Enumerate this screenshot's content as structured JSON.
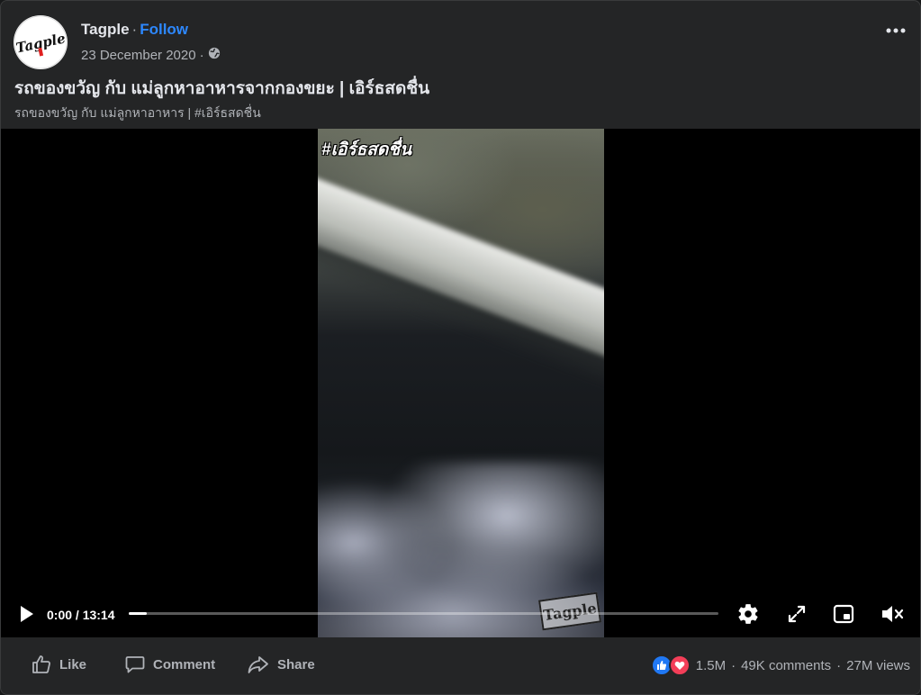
{
  "post": {
    "page_name": "Tagple",
    "follow_label": "Follow",
    "separator": "·",
    "date": "23 December 2020",
    "date_separator": "·",
    "audience_icon": "globe-icon",
    "more_icon": "more-horizontal-icon",
    "avatar_text": "Tagple",
    "title": "รถของขวัญ กับ แม่ลูกหาอาหารจากกองขยะ | เอิร์ธสดชื่น",
    "subtitle": "รถของขวัญ กับ แม่ลูกหาอาหาร | #เอิร์ธสดชื่น"
  },
  "video": {
    "overlay_hashtag": "#เอิร์ธสดชื่น",
    "watermark": "Tagple",
    "time_display": "0:00 / 13:14",
    "progress_fraction": 0.03,
    "controls": {
      "play_icon": "play-icon",
      "settings_icon": "gear-icon",
      "fullscreen_icon": "expand-icon",
      "pip_icon": "picture-in-picture-icon",
      "volume_icon": "volume-muted-icon"
    }
  },
  "footer": {
    "like_label": "Like",
    "comment_label": "Comment",
    "share_label": "Share",
    "reactions_count": "1.5M",
    "comments_count": "49K comments",
    "views_count": "27M views",
    "dot": "·",
    "colors": {
      "like": "#2078f4",
      "love": "#f33e58",
      "accent": "#2d88ff"
    }
  }
}
